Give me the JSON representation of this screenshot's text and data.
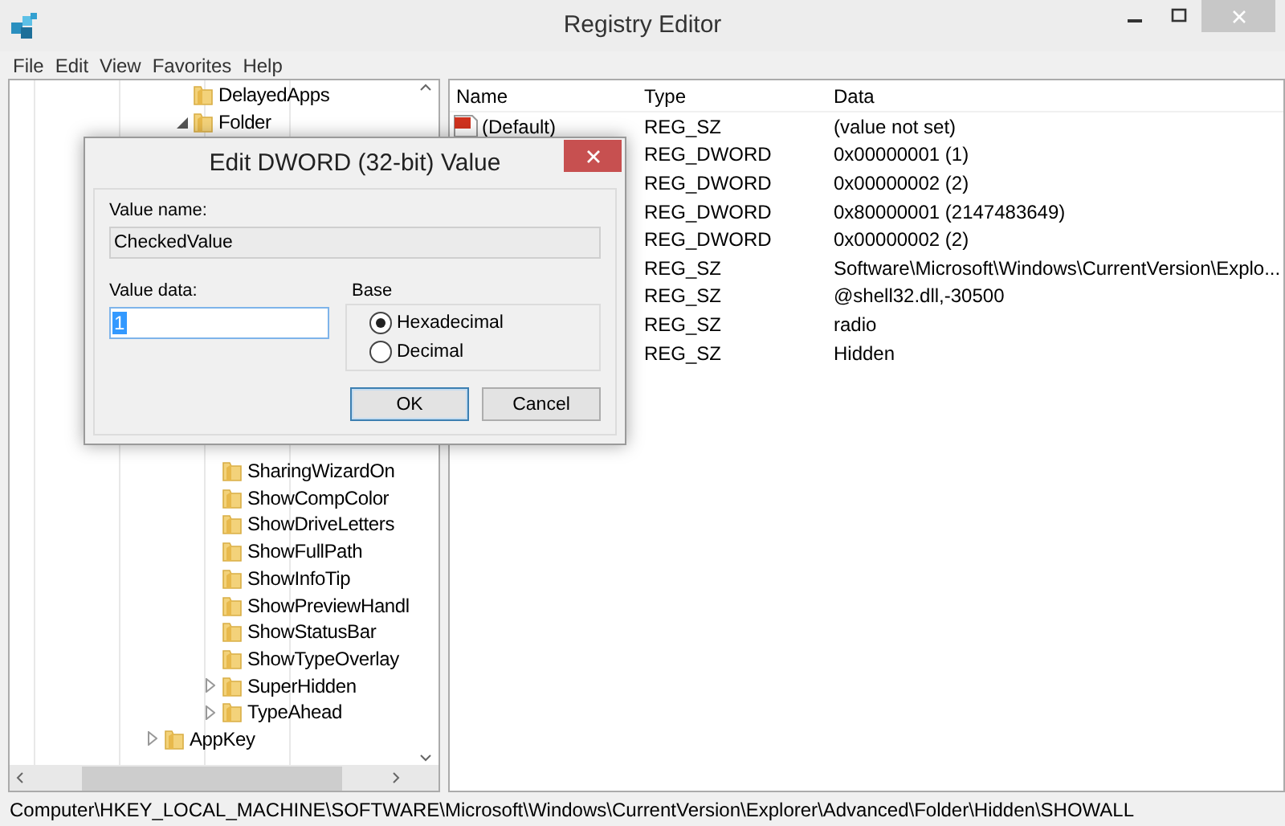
{
  "window": {
    "title": "Registry Editor"
  },
  "menu": [
    "File",
    "Edit",
    "View",
    "Favorites",
    "Help"
  ],
  "tree": [
    {
      "children": [
        {
          "label": "DelayedApps"
        },
        {
          "label": "Folder",
          "expanded": true,
          "children": [
            {
              "label": "SharingWizardOn"
            },
            {
              "label": "ShowCompColor"
            },
            {
              "label": "ShowDriveLetters"
            },
            {
              "label": "ShowFullPath"
            },
            {
              "label": "ShowInfoTip"
            },
            {
              "label": "ShowPreviewHandl"
            },
            {
              "label": "ShowStatusBar"
            },
            {
              "label": "ShowTypeOverlay"
            },
            {
              "label": "SuperHidden",
              "expanded": false
            },
            {
              "label": "TypeAhead",
              "expanded": false
            }
          ]
        }
      ]
    },
    {
      "label": "AppKey",
      "expanded": false
    }
  ],
  "values": {
    "columns": [
      "Name",
      "Type",
      "Data"
    ],
    "rows": [
      {
        "kind": "string",
        "name": "(Default)",
        "type": "REG_SZ",
        "data": "(value not set)"
      },
      {
        "type": "REG_DWORD",
        "data": "0x00000001 (1)"
      },
      {
        "type": "REG_DWORD",
        "data": "0x00000002 (2)"
      },
      {
        "type": "REG_DWORD",
        "data": "0x80000001 (2147483649)"
      },
      {
        "type": "REG_DWORD",
        "data": "0x00000002 (2)"
      },
      {
        "type": "REG_SZ",
        "data": "Software\\Microsoft\\Windows\\CurrentVersion\\Explo..."
      },
      {
        "type": "REG_SZ",
        "data": "@shell32.dll,-30500"
      },
      {
        "type": "REG_SZ",
        "data": "radio"
      },
      {
        "type": "REG_SZ",
        "data": "Hidden"
      }
    ]
  },
  "dialog": {
    "title": "Edit DWORD (32-bit) Value",
    "value_name_label": "Value name:",
    "value_name": "CheckedValue",
    "value_data_label": "Value data:",
    "value_data": "1",
    "base_label": "Base",
    "bases": [
      {
        "label": "Hexadecimal",
        "selected": true
      },
      {
        "label": "Decimal",
        "selected": false
      }
    ],
    "buttons": [
      {
        "label": "OK",
        "default": true
      },
      {
        "label": "Cancel",
        "default": false
      }
    ]
  },
  "status_bar": "Computer\\HKEY_LOCAL_MACHINE\\SOFTWARE\\Microsoft\\Windows\\CurrentVersion\\Explorer\\Advanced\\Folder\\Hidden\\SHOWALL"
}
